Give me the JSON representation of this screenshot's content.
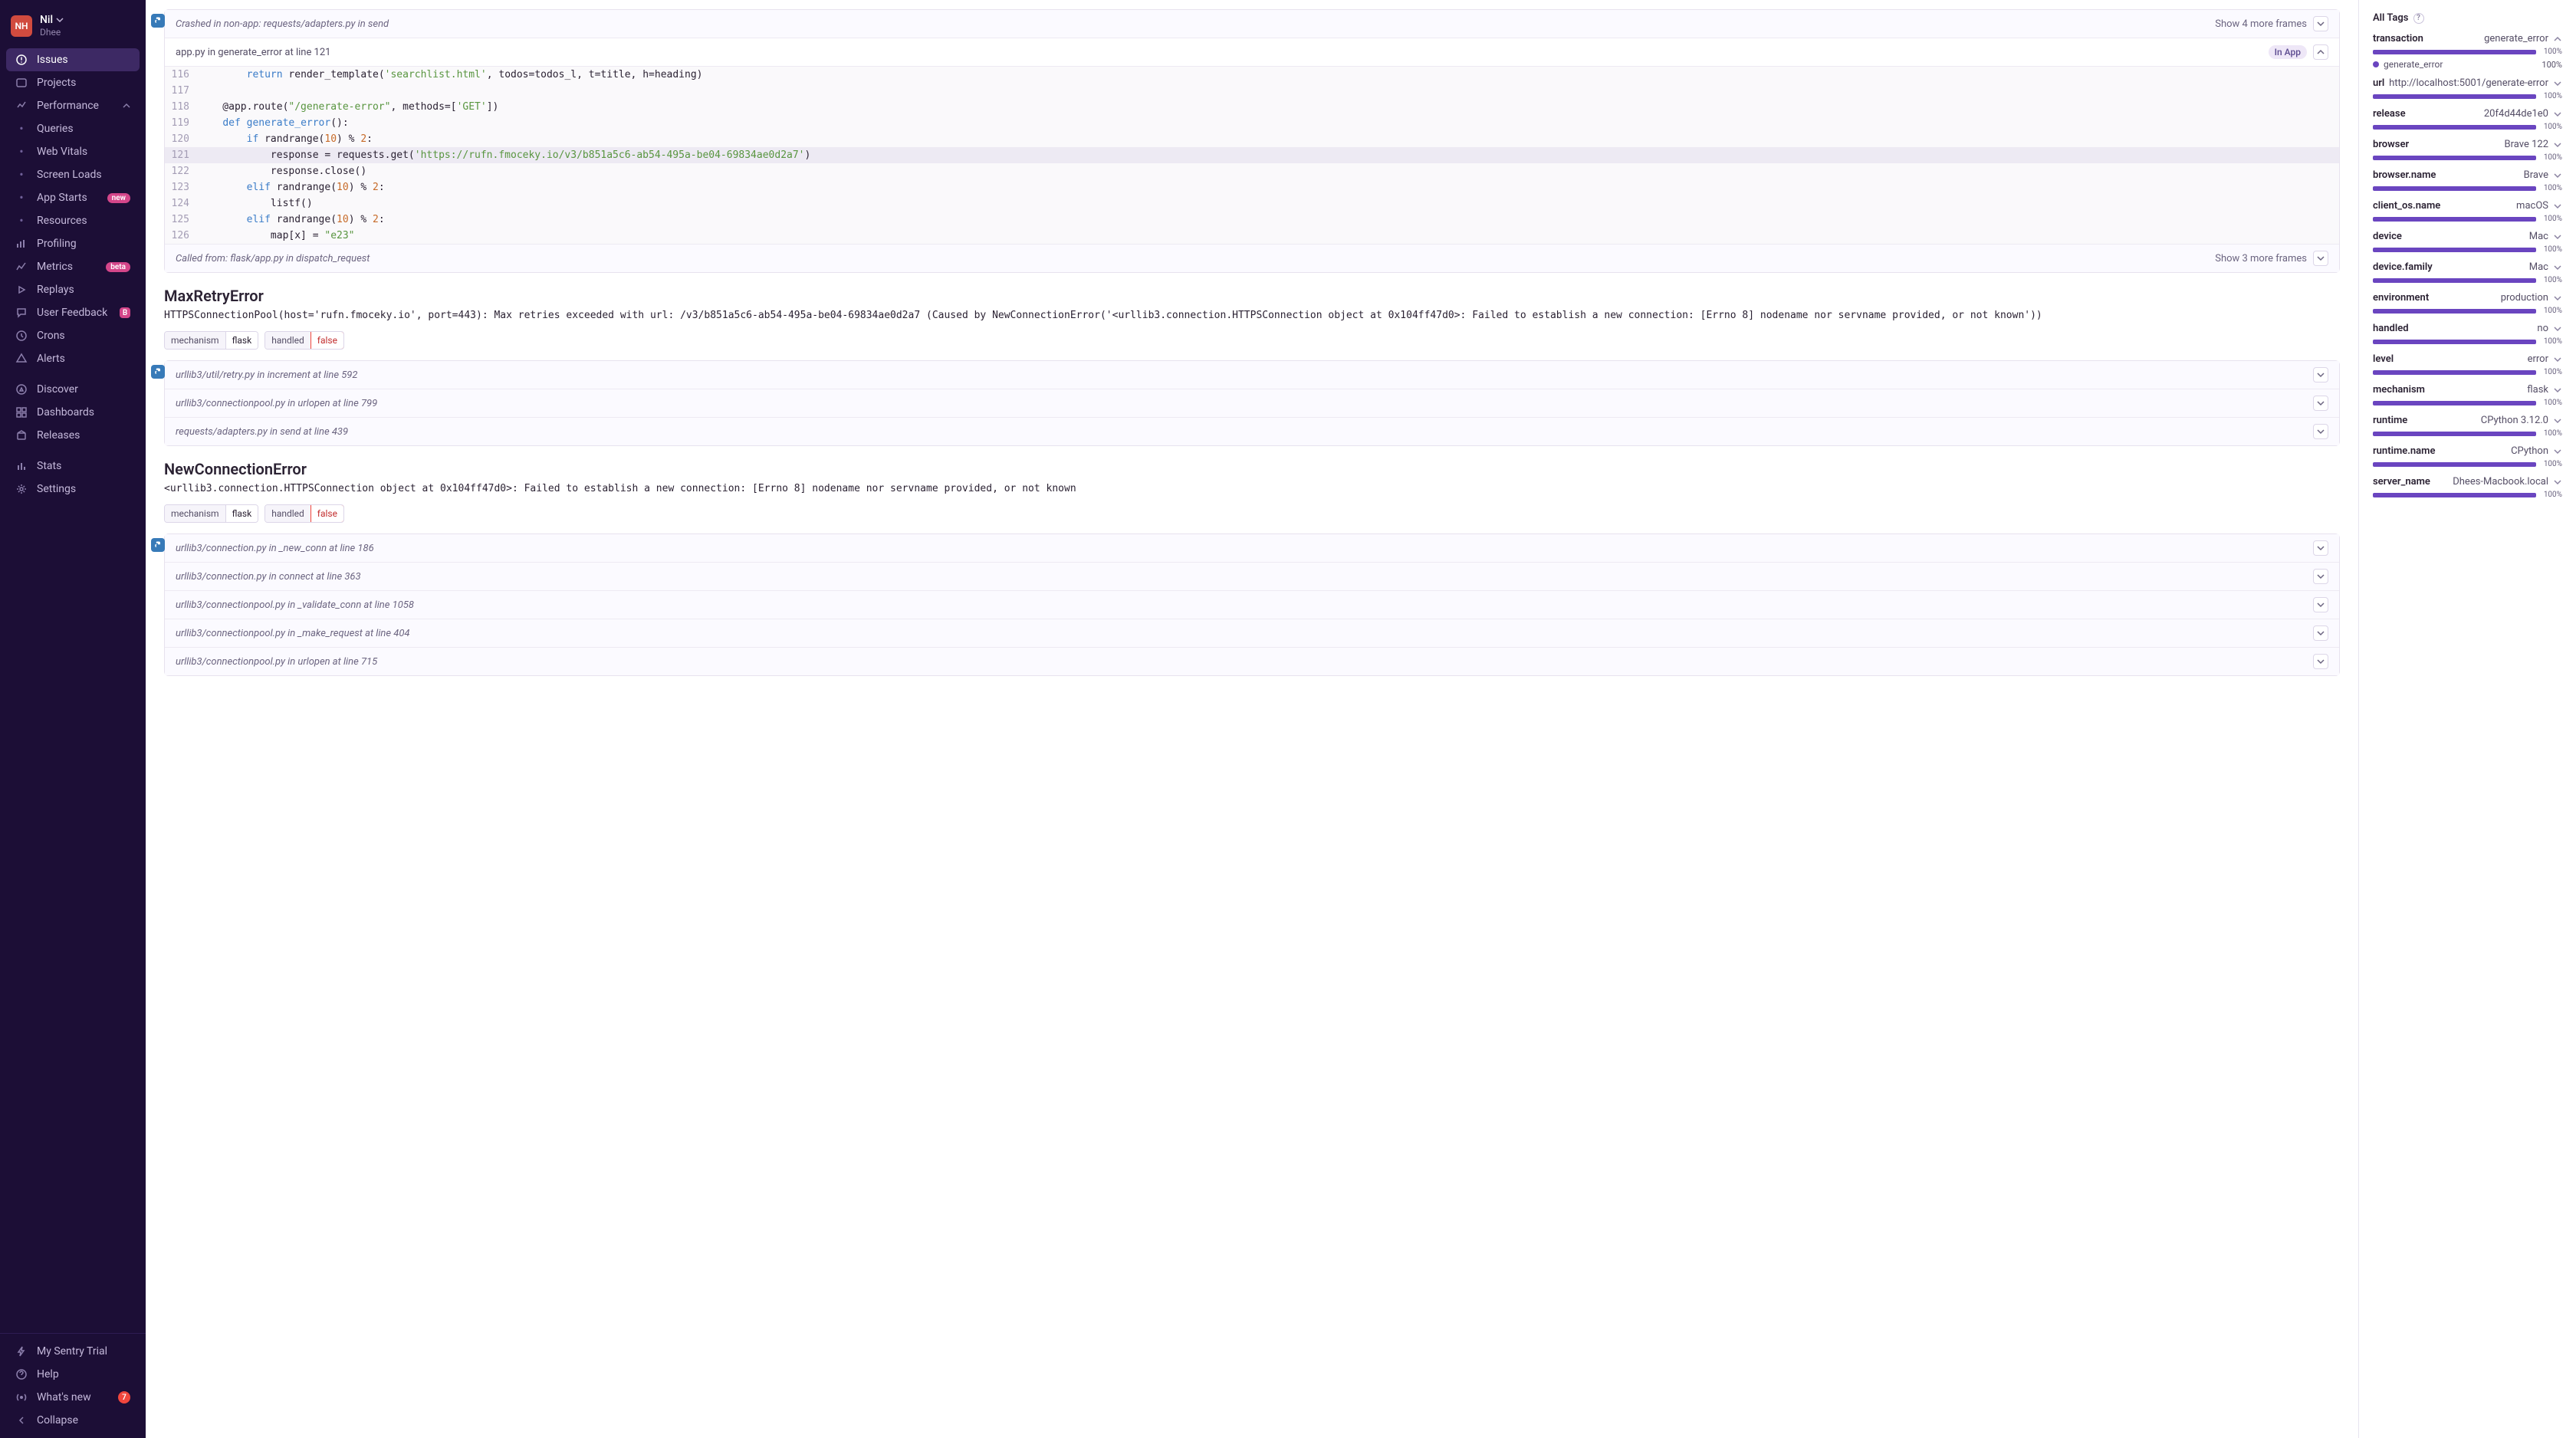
{
  "user": {
    "initials": "NH",
    "name": "Nil",
    "org": "Dhee"
  },
  "nav": {
    "issues": "Issues",
    "projects": "Projects",
    "performance": "Performance",
    "queries": "Queries",
    "webvitals": "Web Vitals",
    "screenloads": "Screen Loads",
    "appstarts": "App Starts",
    "appstarts_badge": "new",
    "resources": "Resources",
    "profiling": "Profiling",
    "metrics": "Metrics",
    "metrics_badge": "beta",
    "replays": "Replays",
    "userfeedback": "User Feedback",
    "userfeedback_badge": "B",
    "crons": "Crons",
    "alerts": "Alerts",
    "discover": "Discover",
    "dashboards": "Dashboards",
    "releases": "Releases",
    "stats": "Stats",
    "settings": "Settings",
    "trial": "My Sentry Trial",
    "help": "Help",
    "whatsnew": "What's new",
    "whatsnew_count": "7",
    "collapse": "Collapse"
  },
  "codecard": {
    "crash_text": "Crashed in non-app: requests/adapters.py  in  send",
    "show_more_top": "Show 4 more frames",
    "file_label": "app.py  in  generate_error  at line  121",
    "in_app": "In App",
    "lines": [
      {
        "n": "116",
        "html": "        <span class='kw'>return</span> render_template(<span class='str'>'searchlist.html'</span>, todos=todos_l, t=title, h=heading)"
      },
      {
        "n": "117",
        "html": ""
      },
      {
        "n": "118",
        "html": "    @app.route(<span class='str'>\"/generate-error\"</span>, methods=[<span class='str'>'GET'</span>])"
      },
      {
        "n": "119",
        "html": "    <span class='kw'>def</span> <span class='fn'>generate_error</span>():"
      },
      {
        "n": "120",
        "html": "        <span class='kw'>if</span> randrange(<span class='num'>10</span>) % <span class='num'>2</span>:"
      },
      {
        "n": "121",
        "html": "            response = requests.get(<span class='str'>'https://rufn.fmoceky.io/v3/b851a5c6-ab54-495a-be04-69834ae0d2a7'</span>)",
        "hl": true
      },
      {
        "n": "122",
        "html": "            response.close()"
      },
      {
        "n": "123",
        "html": "        <span class='kw'>elif</span> randrange(<span class='num'>10</span>) % <span class='num'>2</span>:"
      },
      {
        "n": "124",
        "html": "            listf()"
      },
      {
        "n": "125",
        "html": "        <span class='kw'>elif</span> randrange(<span class='num'>10</span>) % <span class='num'>2</span>:"
      },
      {
        "n": "126",
        "html": "            map[x] = <span class='str'>\"e23\"</span>"
      }
    ],
    "called_from": "Called from: flask/app.py  in  dispatch_request",
    "show_more_bottom": "Show 3 more frames"
  },
  "exc1": {
    "title": "MaxRetryError",
    "msg": "HTTPSConnectionPool(host='rufn.fmoceky.io', port=443): Max retries exceeded with url: /v3/b851a5c6-ab54-495a-be04-69834ae0d2a7 (Caused by NewConnectionError('<urllib3.connection.HTTPSConnection object at 0x104ff47d0>: Failed to establish a new connection: [Errno 8] nodename nor servname provided, or not known'))",
    "tags": [
      [
        "mechanism",
        "flask"
      ],
      [
        "handled",
        "false"
      ]
    ],
    "frames": [
      "urllib3/util/retry.py  in  increment  at line  592",
      "urllib3/connectionpool.py  in  urlopen  at line  799",
      "requests/adapters.py  in  send  at line  439"
    ]
  },
  "exc2": {
    "title": "NewConnectionError",
    "msg": "<urllib3.connection.HTTPSConnection object at 0x104ff47d0>: Failed to establish a new connection: [Errno 8] nodename nor servname provided, or not known",
    "tags": [
      [
        "mechanism",
        "flask"
      ],
      [
        "handled",
        "false"
      ]
    ],
    "frames": [
      "urllib3/connection.py  in  _new_conn  at line  186",
      "urllib3/connection.py  in  connect  at line  363",
      "urllib3/connectionpool.py  in  _validate_conn  at line  1058",
      "urllib3/connectionpool.py  in  _make_request  at line  404",
      "urllib3/connectionpool.py  in  urlopen  at line  715"
    ]
  },
  "alltags": {
    "title": "All Tags",
    "rows": [
      {
        "k": "transaction",
        "v": "generate_error",
        "p": "100%",
        "sub": {
          "v": "generate_error",
          "p": "100%"
        }
      },
      {
        "k": "url",
        "v": "http://localhost:5001/generate-error",
        "p": "100%"
      },
      {
        "k": "release",
        "v": "20f4d44de1e0",
        "p": "100%"
      },
      {
        "k": "browser",
        "v": "Brave 122",
        "p": "100%"
      },
      {
        "k": "browser.name",
        "v": "Brave",
        "p": "100%"
      },
      {
        "k": "client_os.name",
        "v": "macOS",
        "p": "100%"
      },
      {
        "k": "device",
        "v": "Mac",
        "p": "100%"
      },
      {
        "k": "device.family",
        "v": "Mac",
        "p": "100%"
      },
      {
        "k": "environment",
        "v": "production",
        "p": "100%"
      },
      {
        "k": "handled",
        "v": "no",
        "p": "100%"
      },
      {
        "k": "level",
        "v": "error",
        "p": "100%"
      },
      {
        "k": "mechanism",
        "v": "flask",
        "p": "100%"
      },
      {
        "k": "runtime",
        "v": "CPython 3.12.0",
        "p": "100%"
      },
      {
        "k": "runtime.name",
        "v": "CPython",
        "p": "100%"
      },
      {
        "k": "server_name",
        "v": "Dhees-Macbook.local",
        "p": "100%"
      }
    ]
  }
}
